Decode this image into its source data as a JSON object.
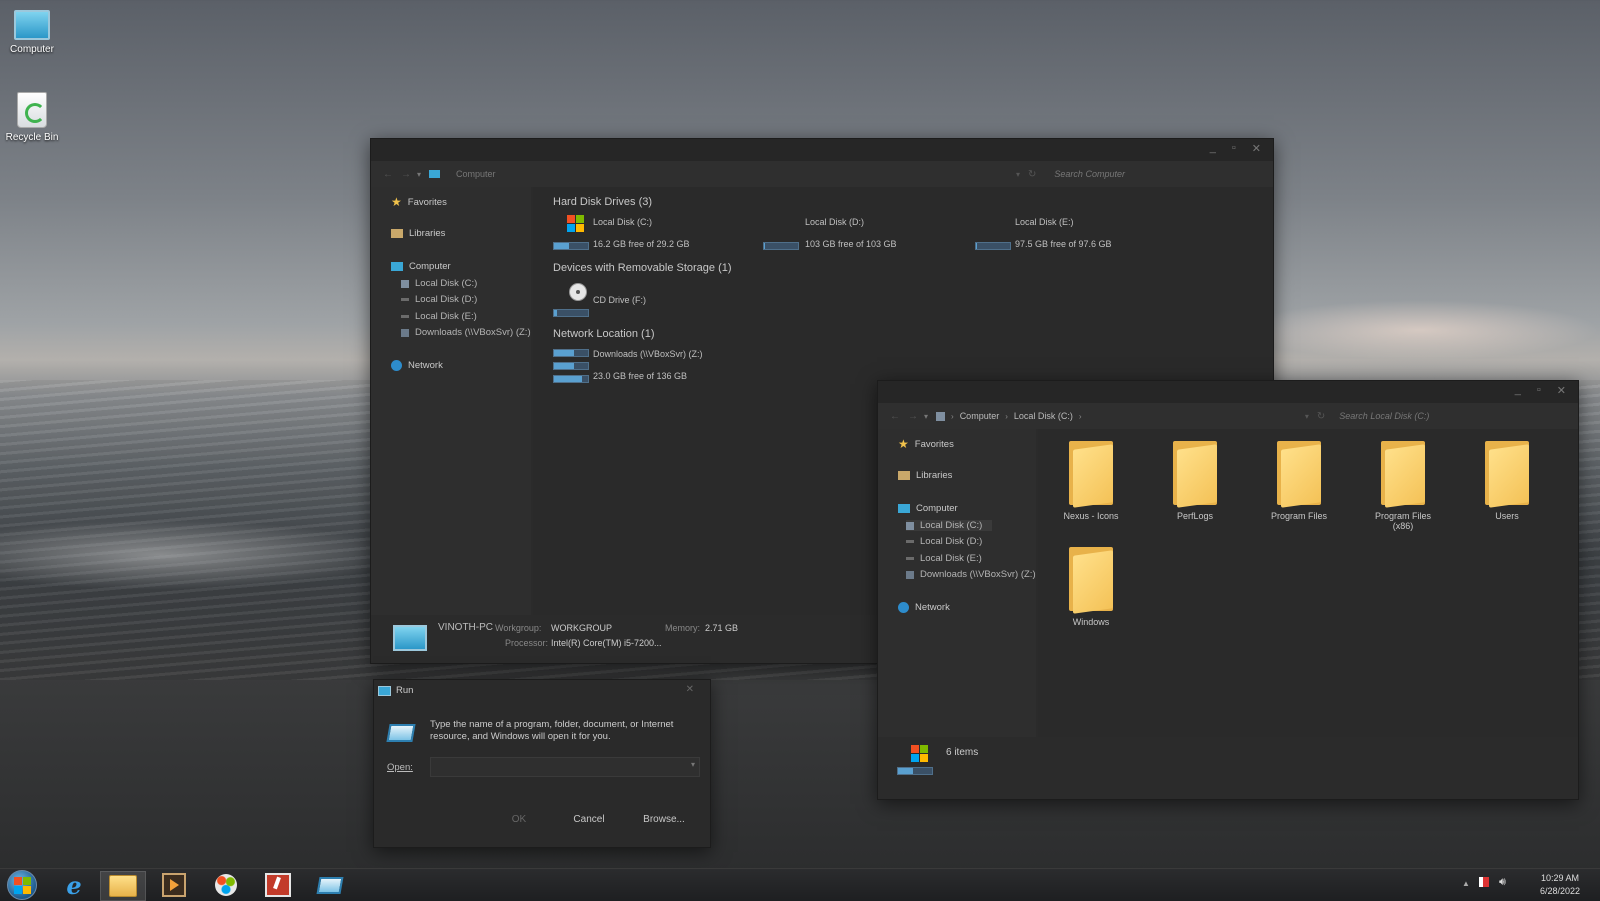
{
  "desktop": {
    "icons": [
      {
        "label": "Computer",
        "icon": "computer-icon"
      },
      {
        "label": "Recycle Bin",
        "icon": "recycle-bin-icon"
      }
    ]
  },
  "computer_window": {
    "address": "Computer",
    "search_placeholder": "Search Computer",
    "nav": {
      "favorites": "Favorites",
      "libraries": "Libraries",
      "computer": "Computer",
      "drives": [
        "Local Disk (C:)",
        "Local Disk (D:)",
        "Local Disk (E:)",
        "Downloads (\\\\VBoxSvr) (Z:)"
      ],
      "network": "Network"
    },
    "groups": {
      "hdd_title": "Hard Disk Drives (3)",
      "removable_title": "Devices with Removable Storage (1)",
      "network_title": "Network Location (1)"
    },
    "drives": [
      {
        "name": "Local Disk (C:)",
        "free": "16.2 GB free of 29.2 GB",
        "used_fraction": 0.45
      },
      {
        "name": "Local Disk (D:)",
        "free": "103 GB free of 103 GB",
        "used_fraction": 0.0
      },
      {
        "name": "Local Disk (E:)",
        "free": "97.5 GB free of 97.6 GB",
        "used_fraction": 0.0
      }
    ],
    "cd_drive": "CD Drive (F:)",
    "network_drive": {
      "name": "Downloads (\\\\VBoxSvr) (Z:)",
      "free": "23.0 GB free of 136 GB",
      "used_fraction": 0.83
    },
    "details": {
      "pc_name": "VINOTH-PC",
      "workgroup_label": "Workgroup:",
      "workgroup": "WORKGROUP",
      "memory_label": "Memory:",
      "memory": "2.71 GB",
      "processor_label": "Processor:",
      "processor": "Intel(R) Core(TM) i5-7200..."
    }
  },
  "localdisk_window": {
    "breadcrumb": [
      "Computer",
      "Local Disk (C:)"
    ],
    "search_placeholder": "Search Local Disk (C:)",
    "nav": {
      "favorites": "Favorites",
      "libraries": "Libraries",
      "computer": "Computer",
      "drives": [
        "Local Disk (C:)",
        "Local Disk (D:)",
        "Local Disk (E:)",
        "Downloads (\\\\VBoxSvr) (Z:)"
      ],
      "network": "Network"
    },
    "folders": [
      "Nexus - Icons",
      "PerfLogs",
      "Program Files",
      "Program Files (x86)",
      "Users",
      "Windows"
    ],
    "status": "6 items"
  },
  "run_dialog": {
    "title": "Run",
    "description": "Type the name of a program, folder, document, or Internet resource, and Windows will open it for you.",
    "open_label": "Open:",
    "open_value": "",
    "ok": "OK",
    "cancel": "Cancel",
    "browse": "Browse..."
  },
  "taskbar": {
    "apps": [
      "start-orb-icon",
      "internet-explorer-icon",
      "file-explorer-icon",
      "media-player-icon",
      "paint-icon",
      "snipping-tool-icon",
      "run-icon"
    ],
    "time": "10:29 AM",
    "date": "6/28/2022"
  },
  "colors": {
    "accent": "#5aa0d0",
    "folder": "#f4c257",
    "window_bg": "#2b2b2b"
  }
}
